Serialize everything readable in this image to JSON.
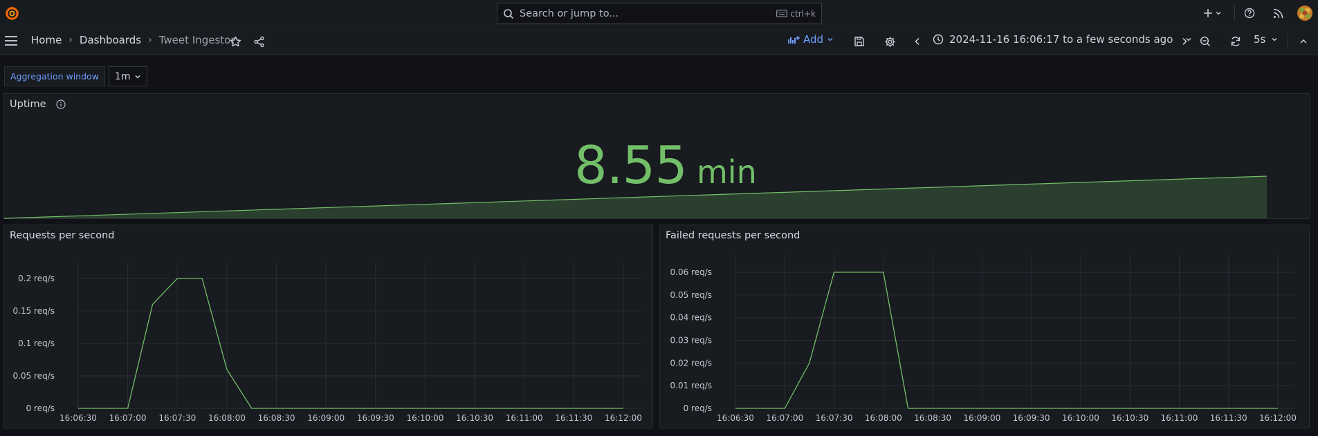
{
  "topbar": {
    "search_placeholder": "Search or jump to...",
    "shortcut": "ctrl+k",
    "icons": [
      "grafana-logo-icon",
      "search-icon",
      "keyboard-icon",
      "plus-icon",
      "help-icon",
      "news-icon",
      "avatar"
    ]
  },
  "navbar": {
    "breadcrumbs": [
      "Home",
      "Dashboards",
      "Tweet Ingestor"
    ],
    "add_label": "Add",
    "time_range": "2024-11-16 16:06:17 to a few seconds ago",
    "refresh_interval": "5s"
  },
  "variables": {
    "label": "Aggregation window",
    "value": "1m"
  },
  "uptime_panel": {
    "title": "Uptime",
    "value": "8.55",
    "unit": "min",
    "sparkline_color": "#73bf69"
  },
  "requests_panel": {
    "title": "Requests per second",
    "chart_data": {
      "type": "line",
      "x": [
        "16:06:30",
        "16:06:45",
        "16:07:00",
        "16:07:15",
        "16:07:30",
        "16:07:45",
        "16:08:00",
        "16:08:15",
        "16:08:30",
        "16:09:00",
        "16:09:30",
        "16:10:00",
        "16:10:30",
        "16:11:00",
        "16:11:30",
        "16:12:00"
      ],
      "series": [
        {
          "values": [
            0,
            0,
            0,
            0.16,
            0.2,
            0.2,
            0.06,
            0,
            0,
            0,
            0,
            0,
            0,
            0,
            0,
            0
          ]
        }
      ],
      "x_ticks": [
        "16:06:30",
        "16:07:00",
        "16:07:30",
        "16:08:00",
        "16:08:30",
        "16:09:00",
        "16:09:30",
        "16:10:00",
        "16:10:30",
        "16:11:00",
        "16:11:30",
        "16:12:00"
      ],
      "y_ticks": [
        "0 req/s",
        "0.05 req/s",
        "0.1 req/s",
        "0.15 req/s",
        "0.2 req/s"
      ],
      "y_values": [
        0,
        0.05,
        0.1,
        0.15,
        0.2
      ],
      "ylim": [
        0,
        0.2
      ],
      "grid": true,
      "color": "#73bf69"
    }
  },
  "failed_panel": {
    "title": "Failed requests per second",
    "chart_data": {
      "type": "line",
      "x": [
        "16:06:30",
        "16:06:45",
        "16:07:00",
        "16:07:15",
        "16:07:30",
        "16:07:45",
        "16:08:00",
        "16:08:15",
        "16:08:30",
        "16:09:00",
        "16:09:30",
        "16:10:00",
        "16:10:30",
        "16:11:00",
        "16:11:30",
        "16:12:00"
      ],
      "series": [
        {
          "values": [
            0,
            0,
            0,
            0.02,
            0.06,
            0.06,
            0.06,
            0,
            0,
            0,
            0,
            0,
            0,
            0,
            0,
            0
          ]
        }
      ],
      "x_ticks": [
        "16:06:30",
        "16:07:00",
        "16:07:30",
        "16:08:00",
        "16:08:30",
        "16:09:00",
        "16:09:30",
        "16:10:00",
        "16:10:30",
        "16:11:00",
        "16:11:30",
        "16:12:00"
      ],
      "y_ticks": [
        "0 req/s",
        "0.01 req/s",
        "0.02 req/s",
        "0.03 req/s",
        "0.04 req/s",
        "0.05 req/s",
        "0.06 req/s"
      ],
      "y_values": [
        0,
        0.01,
        0.02,
        0.03,
        0.04,
        0.05,
        0.06
      ],
      "ylim": [
        0,
        0.06
      ],
      "grid": true,
      "color": "#73bf69"
    }
  }
}
